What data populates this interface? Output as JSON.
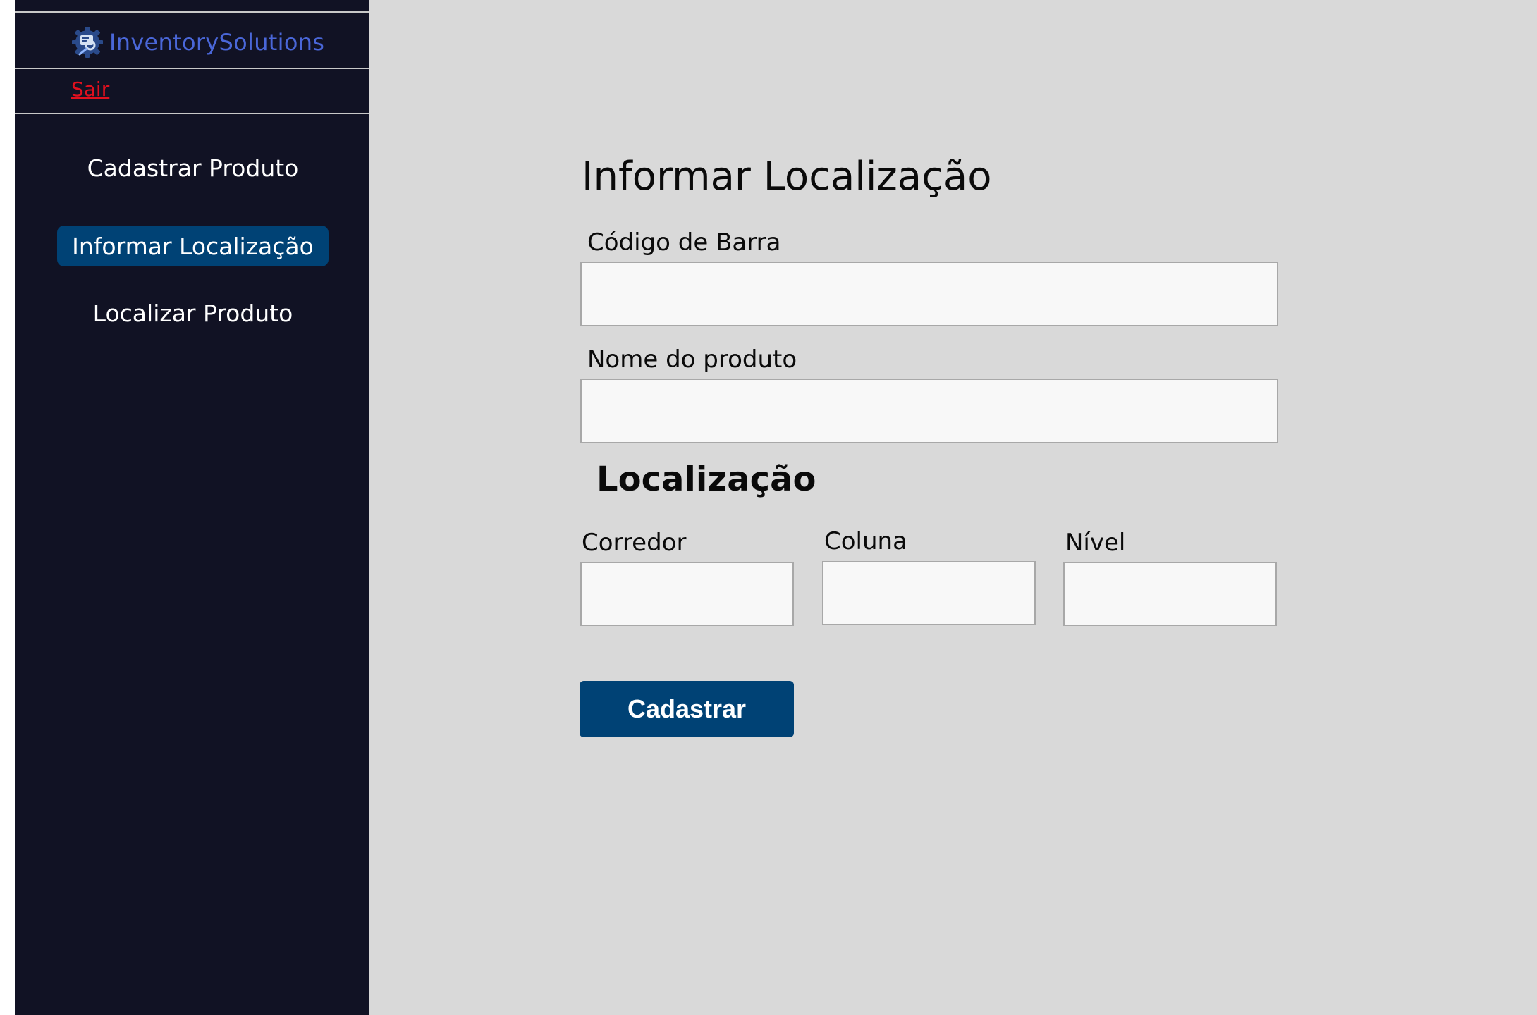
{
  "sidebar": {
    "brand": {
      "name": "InventorySolutions",
      "icon": "inventory-gear-icon",
      "color": "#4a67d9"
    },
    "logout_label": "Sair",
    "items": [
      {
        "label": "Cadastrar Produto",
        "active": false
      },
      {
        "label": "Informar Localização",
        "active": true
      },
      {
        "label": "Localizar Produto",
        "active": false
      }
    ],
    "background": "#111224",
    "active_color": "#004275"
  },
  "main": {
    "title": "Informar Localização",
    "barcode": {
      "label": "Código de Barra",
      "value": ""
    },
    "product_name": {
      "label": "Nome do produto",
      "value": ""
    },
    "location_section": {
      "title": "Localização",
      "corridor": {
        "label": "Corredor",
        "value": ""
      },
      "column": {
        "label": "Coluna",
        "value": ""
      },
      "level": {
        "label": "Nível",
        "value": ""
      }
    },
    "submit_label": "Cadastrar"
  }
}
